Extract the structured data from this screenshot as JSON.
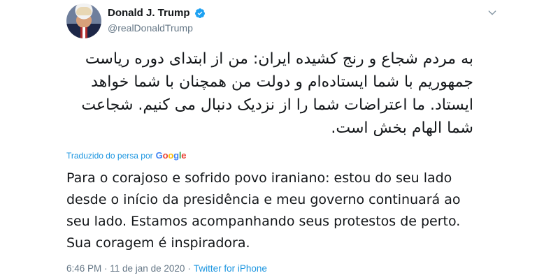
{
  "tweet": {
    "author_name": "Donald J. Trump",
    "author_handle": "@realDonaldTrump",
    "original_text": "به مردم شجاع و رنج کشیده ایران: من از ابتدای دوره ریاست جمهوریم با شما ایستاده‌ام و دولت من همچنان با شما خواهد ایستاد. ما اعتراضات شما را از نزدیک دنبال می کنیم. شجاعت شما الهام بخش است.",
    "translated_by_label": "Traduzido do persa por",
    "google_letters": [
      "G",
      "o",
      "o",
      "g",
      "l",
      "e"
    ],
    "translation_text": "Para o corajoso e sofrido povo iraniano: estou do seu lado desde o início da presidência e meu governo continuará ao seu lado. Estamos acompanhando seus protestos de perto. Sua coragem é inspiradora.",
    "timestamp": "6:46 PM · 11 de jan de 2020",
    "separator": "·",
    "source": "Twitter for iPhone"
  },
  "icons": {
    "verified": "verified-badge-icon",
    "caret": "chevron-down-icon"
  },
  "colors": {
    "link_blue": "#1b95e0",
    "verified_blue": "#1da1f2",
    "text_primary": "#14171a",
    "text_secondary": "#657786",
    "google_blue": "#4285f4",
    "google_red": "#ea4335",
    "google_yellow": "#fbbc05",
    "google_green": "#34a853"
  }
}
